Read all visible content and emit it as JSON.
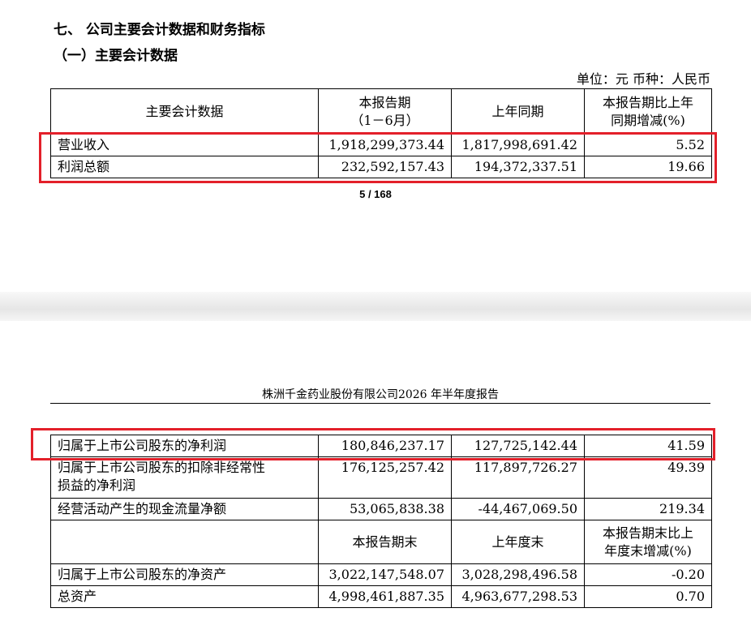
{
  "section": {
    "title": "七、  公司主要会计数据和财务指标",
    "subtitle": "（一）主要会计数据",
    "unit": "单位：元  币种：人民币"
  },
  "page_number": "5 / 168",
  "running_header": "株洲千金药业股份有限公司2026 年半年度报告",
  "table1": {
    "headers": {
      "col1": "主要会计数据",
      "col2_line1": "本报告期",
      "col2_line2": "（1－6月）",
      "col3": "上年同期",
      "col4_line1": "本报告期比上年",
      "col4_line2": "同期增减(%)"
    },
    "rows": [
      {
        "label": "营业收入",
        "current": "1,918,299,373.44",
        "prior": "1,817,998,691.42",
        "change": "5.52"
      },
      {
        "label": "利润总额",
        "current": "232,592,157.43",
        "prior": "194,372,337.51",
        "change": "19.66"
      }
    ]
  },
  "table2": {
    "rows": [
      {
        "label": "归属于上市公司股东的净利润",
        "current": "180,846,237.17",
        "prior": "127,725,142.44",
        "change": "41.59"
      },
      {
        "label_line1": "归属于上市公司股东的扣除非经常性",
        "label_line2": "损益的净利润",
        "current": "176,125,257.42",
        "prior": "117,897,726.27",
        "change": "49.39"
      },
      {
        "label": "经营活动产生的现金流量净额",
        "current": "53,065,838.38",
        "prior": "-44,467,069.50",
        "change": "219.34"
      }
    ],
    "subheaders": {
      "col2": "本报告期末",
      "col3": "上年度末",
      "col4_line1": "本报告期末比上",
      "col4_line2": "年度末增减(%)"
    },
    "rows_end": [
      {
        "label": "归属于上市公司股东的净资产",
        "current": "3,022,147,548.07",
        "prior": "3,028,298,496.58",
        "change": "-0.20"
      },
      {
        "label": "总资产",
        "current": "4,998,461,887.35",
        "prior": "4,963,677,298.53",
        "change": "0.70"
      }
    ]
  },
  "colors": {
    "highlight": "#e3202a"
  }
}
